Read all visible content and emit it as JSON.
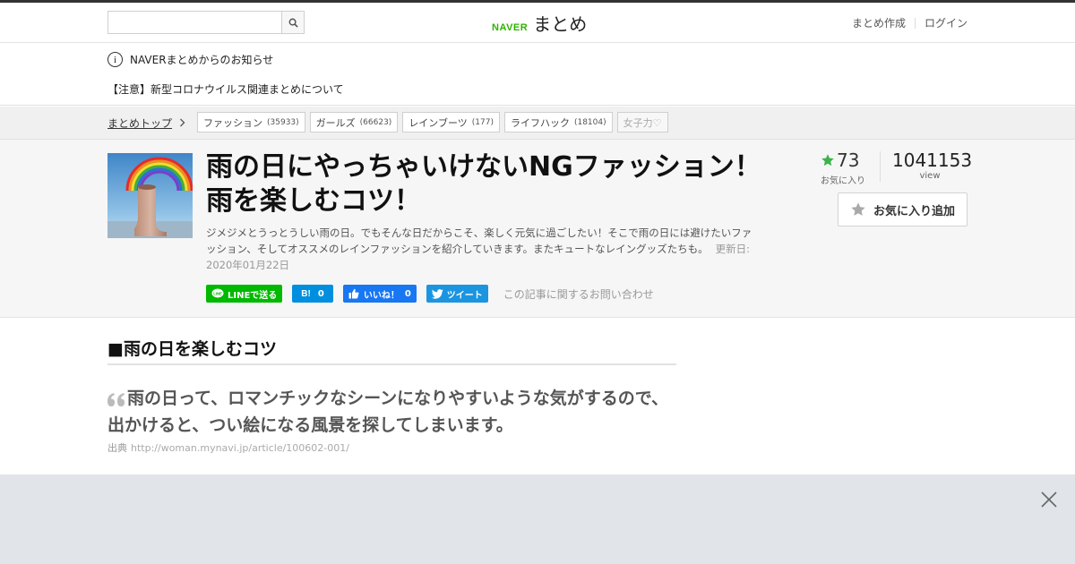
{
  "header": {
    "search_placeholder": "",
    "logo_brand": "NAVER",
    "logo_name": "まとめ",
    "links": [
      "まとめ作成",
      "ログイン"
    ]
  },
  "notice": {
    "heading": "NAVERまとめからのお知らせ",
    "item": "【注意】新型コロナウイルス関連まとめについて"
  },
  "breadcrumb": {
    "top_label": "まとめトップ"
  },
  "tags": [
    {
      "label": "ファッション",
      "count": "(35933)"
    },
    {
      "label": "ガールズ",
      "count": "(66623)"
    },
    {
      "label": "レインブーツ",
      "count": "(177)"
    },
    {
      "label": "ライフハック",
      "count": "(18104)"
    },
    {
      "label": "女子力♡",
      "count": ""
    }
  ],
  "article": {
    "title": "雨の日にやっちゃいけないNGファッション！雨を楽しむコツ！",
    "description": "ジメジメとうっとうしい雨の日。でもそんな日だからこそ、楽しく元気に過ごしたい！そこで雨の日には避けたいファッション、そしてオススメのレインファッションを紹介していきます。またキュートなレイングッズたちも。",
    "updated": "更新日: 2020年01月22日",
    "favorites": "73",
    "favorites_label": "お気に入り",
    "views": "1041153",
    "views_label": "view",
    "fav_button": "お気に入り追加"
  },
  "share": {
    "line": "LINEで送る",
    "hatena_icon": "B!",
    "hatena_count": "0",
    "facebook": "いいね！",
    "facebook_count": "0",
    "twitter": "ツイート",
    "inquiry": "この記事に関するお問い合わせ"
  },
  "content": {
    "section_heading": "■雨の日を楽しむコツ",
    "quote": "雨の日って、ロマンチックなシーンになりやすいような気がするので、出かけると、つい絵になる風景を探してしまいます。",
    "source_label": "出典",
    "source_url": "http://woman.mynavi.jp/article/100602-001/"
  },
  "icons": {
    "search": "search-icon",
    "info": "info-icon",
    "chevron": "chevron-right-icon",
    "star": "star-icon",
    "close": "close-icon",
    "line": "line-icon",
    "facebook": "thumbs-up-icon",
    "twitter": "twitter-bird-icon"
  },
  "colors": {
    "brand_green": "#2db400",
    "line_green": "#00b900",
    "hatena_blue": "#008fde",
    "facebook_blue": "#1877f2",
    "twitter_blue": "#1b95e0",
    "star_green": "#3cb34a",
    "bottom_panel": "#e1e4e8"
  }
}
